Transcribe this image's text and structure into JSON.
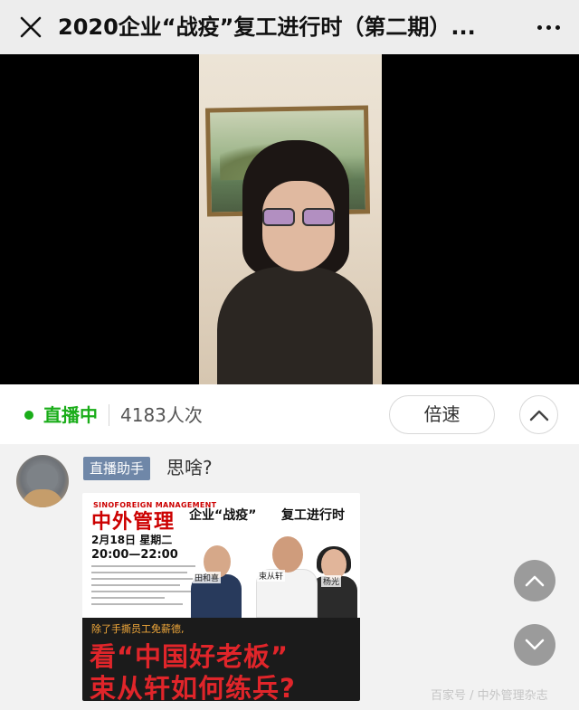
{
  "topbar": {
    "title": "2020企业“战疫”复工进行时（第二期）...",
    "close_icon": "close-icon",
    "more_icon": "more-icon"
  },
  "video": {
    "description_icon": "live-video-feed"
  },
  "status": {
    "live_label": "直播中",
    "viewers": "4183人次",
    "speed_label": "倍速",
    "collapse_icon": "chevron-up-icon",
    "live_color": "#1aad19"
  },
  "chat": {
    "badge": "直播助手",
    "message": "思啥?",
    "badge_color": "#6f87a8"
  },
  "poster": {
    "logo_top": "SINOFOREIGN MANAGEMENT",
    "logo": "中外管理",
    "headline_a": "企业“战疫”",
    "headline_b": "复工进行时",
    "date": "2月18日 星期二",
    "time": "20:00—22:00",
    "guest1": "田和喜",
    "guest2": "束从轩",
    "guest3": "杨光",
    "subline": "除了手撕员工免薪德,",
    "big_line1": "看“中国好老板”",
    "big_line2": "束从轩如何练兵?"
  },
  "fab": {
    "up_icon": "chevron-up-icon",
    "down_icon": "chevron-down-icon"
  },
  "watermark": "百家号 / 中外管理杂志"
}
